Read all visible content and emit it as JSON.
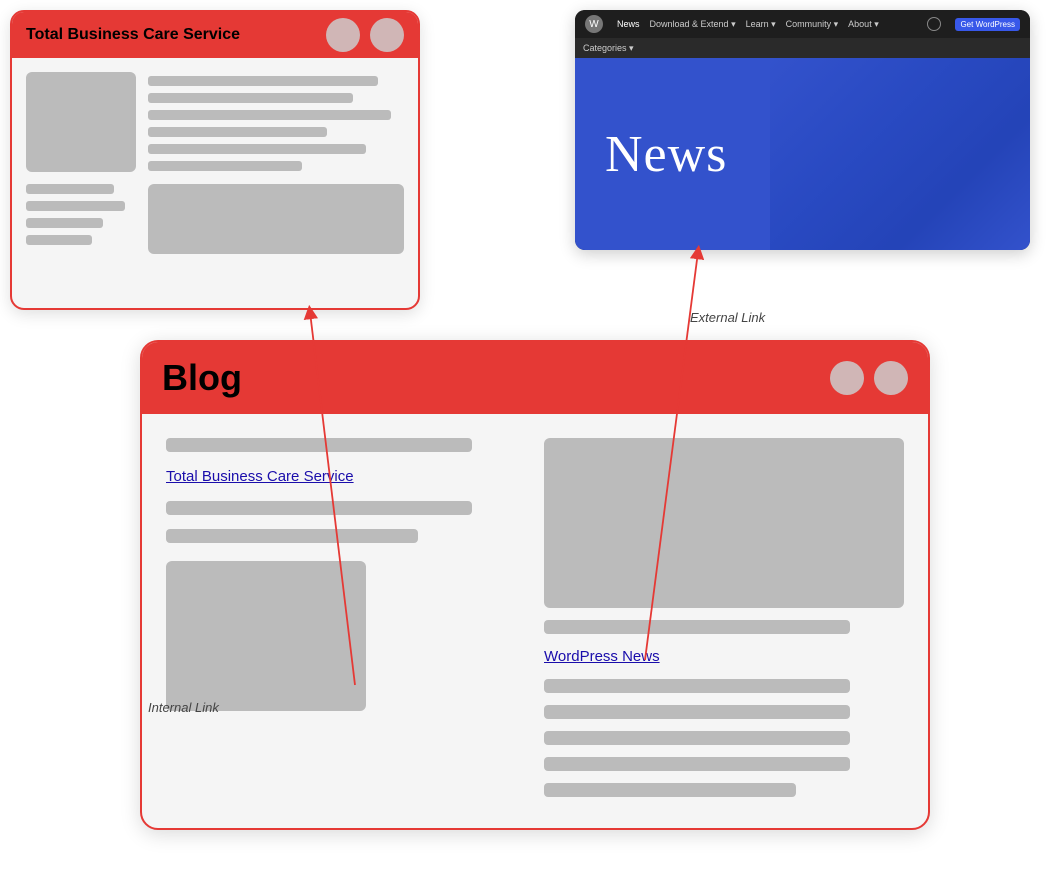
{
  "blog_window": {
    "title": "Blog",
    "internal_link_label": "Internal Link",
    "external_link_label": "External Link",
    "left_column": {
      "link_text": "Total Business Care Service"
    },
    "right_column": {
      "link_text": "WordPress News"
    }
  },
  "tbcs_window": {
    "title": "Total Business Care Service"
  },
  "wp_window": {
    "nav_items": [
      "News",
      "Download & Extend ▾",
      "Learn ▾",
      "Community ▾",
      "About ▾"
    ],
    "get_btn": "Get WordPress",
    "categories": "Categories ▾",
    "hero_text": "News"
  },
  "labels": {
    "internal_left": "Internal Link",
    "external_right": "External Link"
  },
  "colors": {
    "red": "#e53935",
    "link": "#1a0dab",
    "gray": "#bbb",
    "dark": "#1e1e1e",
    "blue_hero": "#3352cc"
  }
}
